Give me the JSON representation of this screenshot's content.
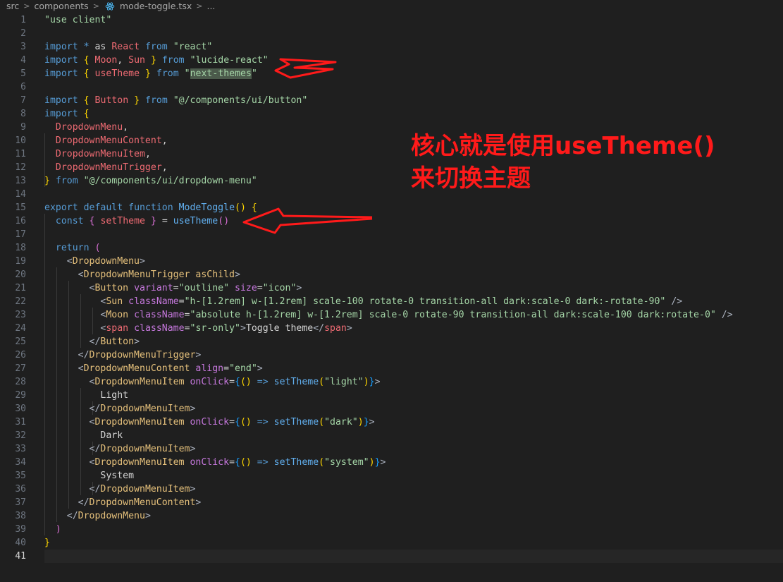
{
  "breadcrumb": {
    "items": [
      "src",
      "components",
      "mode-toggle.tsx",
      "..."
    ],
    "separator": ">",
    "file_icon": "react-icon"
  },
  "annotation": {
    "line1": "核心就是使用useTheme()",
    "line2": "来切换主题",
    "color": "#ff1a1a"
  },
  "editor": {
    "current_line": 41,
    "lines": [
      {
        "n": "1",
        "tokens": [
          [
            "\"use client\"",
            "t-str"
          ]
        ]
      },
      {
        "n": "2",
        "tokens": []
      },
      {
        "n": "3",
        "tokens": [
          [
            "import",
            "t-blue"
          ],
          [
            " ",
            "t-txt"
          ],
          [
            "*",
            "t-blue"
          ],
          [
            " as ",
            "t-txt"
          ],
          [
            "React",
            "t-imp"
          ],
          [
            " ",
            "t-txt"
          ],
          [
            "from",
            "t-blue"
          ],
          [
            " ",
            "t-txt"
          ],
          [
            "\"react\"",
            "t-str"
          ]
        ]
      },
      {
        "n": "4",
        "tokens": [
          [
            "import",
            "t-blue"
          ],
          [
            " ",
            "t-txt"
          ],
          [
            "{",
            "t-br1"
          ],
          [
            " ",
            "t-txt"
          ],
          [
            "Moon",
            "t-imp"
          ],
          [
            ", ",
            "t-txt"
          ],
          [
            "Sun",
            "t-imp"
          ],
          [
            " ",
            "t-txt"
          ],
          [
            "}",
            "t-br1"
          ],
          [
            " ",
            "t-txt"
          ],
          [
            "from",
            "t-blue"
          ],
          [
            " ",
            "t-txt"
          ],
          [
            "\"lucide-react\"",
            "t-str"
          ]
        ]
      },
      {
        "n": "5",
        "tokens": [
          [
            "import",
            "t-blue"
          ],
          [
            " ",
            "t-txt"
          ],
          [
            "{",
            "t-br1"
          ],
          [
            " ",
            "t-txt"
          ],
          [
            "useTheme",
            "t-imp"
          ],
          [
            " ",
            "t-txt"
          ],
          [
            "}",
            "t-br1"
          ],
          [
            " ",
            "t-txt"
          ],
          [
            "from",
            "t-blue"
          ],
          [
            " ",
            "t-txt"
          ],
          [
            "\"",
            "t-str"
          ],
          [
            "next-themes",
            "t-hl"
          ],
          [
            "\"",
            "t-str"
          ]
        ]
      },
      {
        "n": "6",
        "tokens": []
      },
      {
        "n": "7",
        "tokens": [
          [
            "import",
            "t-blue"
          ],
          [
            " ",
            "t-txt"
          ],
          [
            "{",
            "t-br1"
          ],
          [
            " ",
            "t-txt"
          ],
          [
            "Button",
            "t-imp"
          ],
          [
            " ",
            "t-txt"
          ],
          [
            "}",
            "t-br1"
          ],
          [
            " ",
            "t-txt"
          ],
          [
            "from",
            "t-blue"
          ],
          [
            " ",
            "t-txt"
          ],
          [
            "\"@/components/ui/button\"",
            "t-str"
          ]
        ]
      },
      {
        "n": "8",
        "tokens": [
          [
            "import",
            "t-blue"
          ],
          [
            " ",
            "t-txt"
          ],
          [
            "{",
            "t-br1"
          ]
        ]
      },
      {
        "n": "9",
        "tokens": [
          [
            "  ",
            "t-txt"
          ],
          [
            "DropdownMenu",
            "t-imp"
          ],
          [
            ",",
            "t-txt"
          ]
        ]
      },
      {
        "n": "10",
        "tokens": [
          [
            "  ",
            "t-txt"
          ],
          [
            "DropdownMenuContent",
            "t-imp"
          ],
          [
            ",",
            "t-txt"
          ]
        ]
      },
      {
        "n": "11",
        "tokens": [
          [
            "  ",
            "t-txt"
          ],
          [
            "DropdownMenuItem",
            "t-imp"
          ],
          [
            ",",
            "t-txt"
          ]
        ]
      },
      {
        "n": "12",
        "tokens": [
          [
            "  ",
            "t-txt"
          ],
          [
            "DropdownMenuTrigger",
            "t-imp"
          ],
          [
            ",",
            "t-txt"
          ]
        ]
      },
      {
        "n": "13",
        "tokens": [
          [
            "}",
            "t-br1"
          ],
          [
            " ",
            "t-txt"
          ],
          [
            "from",
            "t-blue"
          ],
          [
            " ",
            "t-txt"
          ],
          [
            "\"@/components/ui/dropdown-menu\"",
            "t-str"
          ]
        ]
      },
      {
        "n": "14",
        "tokens": []
      },
      {
        "n": "15",
        "tokens": [
          [
            "export",
            "t-blue"
          ],
          [
            " ",
            "t-txt"
          ],
          [
            "default",
            "t-blue"
          ],
          [
            " ",
            "t-txt"
          ],
          [
            "function",
            "t-blue"
          ],
          [
            " ",
            "t-txt"
          ],
          [
            "ModeToggle",
            "t-fn"
          ],
          [
            "()",
            "t-br1"
          ],
          [
            " ",
            "t-txt"
          ],
          [
            "{",
            "t-br1"
          ]
        ]
      },
      {
        "n": "16",
        "tokens": [
          [
            "  ",
            "t-txt"
          ],
          [
            "const",
            "t-blue"
          ],
          [
            " ",
            "t-txt"
          ],
          [
            "{",
            "t-br2"
          ],
          [
            " ",
            "t-txt"
          ],
          [
            "setTheme",
            "t-imp"
          ],
          [
            " ",
            "t-txt"
          ],
          [
            "}",
            "t-br2"
          ],
          [
            " = ",
            "t-txt"
          ],
          [
            "useTheme",
            "t-fn"
          ],
          [
            "()",
            "t-br2"
          ]
        ]
      },
      {
        "n": "17",
        "tokens": []
      },
      {
        "n": "18",
        "tokens": [
          [
            "  ",
            "t-txt"
          ],
          [
            "return",
            "t-blue"
          ],
          [
            " ",
            "t-txt"
          ],
          [
            "(",
            "t-br2"
          ]
        ]
      },
      {
        "n": "19",
        "tokens": [
          [
            "    ",
            "t-txt"
          ],
          [
            "<",
            "t-punc"
          ],
          [
            "DropdownMenu",
            "t-jsx"
          ],
          [
            ">",
            "t-punc"
          ]
        ]
      },
      {
        "n": "20",
        "tokens": [
          [
            "      ",
            "t-txt"
          ],
          [
            "<",
            "t-punc"
          ],
          [
            "DropdownMenuTrigger",
            "t-jsx"
          ],
          [
            " ",
            "t-txt"
          ],
          [
            "asChild",
            "t-jsx"
          ],
          [
            ">",
            "t-punc"
          ]
        ]
      },
      {
        "n": "21",
        "tokens": [
          [
            "        ",
            "t-txt"
          ],
          [
            "<",
            "t-punc"
          ],
          [
            "Button",
            "t-jsx"
          ],
          [
            " ",
            "t-txt"
          ],
          [
            "variant",
            "t-attr"
          ],
          [
            "=",
            "t-txt"
          ],
          [
            "\"outline\"",
            "t-str"
          ],
          [
            " ",
            "t-txt"
          ],
          [
            "size",
            "t-attr"
          ],
          [
            "=",
            "t-txt"
          ],
          [
            "\"icon\"",
            "t-str"
          ],
          [
            ">",
            "t-punc"
          ]
        ]
      },
      {
        "n": "22",
        "tokens": [
          [
            "          ",
            "t-txt"
          ],
          [
            "<",
            "t-punc"
          ],
          [
            "Sun",
            "t-jsx"
          ],
          [
            " ",
            "t-txt"
          ],
          [
            "className",
            "t-attr"
          ],
          [
            "=",
            "t-txt"
          ],
          [
            "\"h-[1.2rem] w-[1.2rem] scale-100 rotate-0 transition-all dark:scale-0 dark:-rotate-90\"",
            "t-str"
          ],
          [
            " />",
            "t-punc"
          ]
        ]
      },
      {
        "n": "23",
        "tokens": [
          [
            "          ",
            "t-txt"
          ],
          [
            "<",
            "t-punc"
          ],
          [
            "Moon",
            "t-jsx"
          ],
          [
            " ",
            "t-txt"
          ],
          [
            "className",
            "t-attr"
          ],
          [
            "=",
            "t-txt"
          ],
          [
            "\"absolute h-[1.2rem] w-[1.2rem] scale-0 rotate-90 transition-all dark:scale-100 dark:rotate-0\"",
            "t-str"
          ],
          [
            " />",
            "t-punc"
          ]
        ]
      },
      {
        "n": "24",
        "tokens": [
          [
            "          ",
            "t-txt"
          ],
          [
            "<",
            "t-punc"
          ],
          [
            "span",
            "t-tag"
          ],
          [
            " ",
            "t-txt"
          ],
          [
            "className",
            "t-attr"
          ],
          [
            "=",
            "t-txt"
          ],
          [
            "\"sr-only\"",
            "t-str"
          ],
          [
            ">",
            "t-punc"
          ],
          [
            "Toggle theme",
            "t-txt"
          ],
          [
            "</",
            "t-punc"
          ],
          [
            "span",
            "t-tag"
          ],
          [
            ">",
            "t-punc"
          ]
        ]
      },
      {
        "n": "25",
        "tokens": [
          [
            "        ",
            "t-txt"
          ],
          [
            "</",
            "t-punc"
          ],
          [
            "Button",
            "t-jsx"
          ],
          [
            ">",
            "t-punc"
          ]
        ]
      },
      {
        "n": "26",
        "tokens": [
          [
            "      ",
            "t-txt"
          ],
          [
            "</",
            "t-punc"
          ],
          [
            "DropdownMenuTrigger",
            "t-jsx"
          ],
          [
            ">",
            "t-punc"
          ]
        ]
      },
      {
        "n": "27",
        "tokens": [
          [
            "      ",
            "t-txt"
          ],
          [
            "<",
            "t-punc"
          ],
          [
            "DropdownMenuContent",
            "t-jsx"
          ],
          [
            " ",
            "t-txt"
          ],
          [
            "align",
            "t-attr"
          ],
          [
            "=",
            "t-txt"
          ],
          [
            "\"end\"",
            "t-str"
          ],
          [
            ">",
            "t-punc"
          ]
        ]
      },
      {
        "n": "28",
        "tokens": [
          [
            "        ",
            "t-txt"
          ],
          [
            "<",
            "t-punc"
          ],
          [
            "DropdownMenuItem",
            "t-jsx"
          ],
          [
            " ",
            "t-txt"
          ],
          [
            "onClick",
            "t-attr"
          ],
          [
            "=",
            "t-txt"
          ],
          [
            "{",
            "t-br3"
          ],
          [
            "()",
            "t-br1"
          ],
          [
            " => ",
            "t-blue"
          ],
          [
            "setTheme",
            "t-fn"
          ],
          [
            "(",
            "t-br1"
          ],
          [
            "\"light\"",
            "t-str"
          ],
          [
            ")",
            "t-br1"
          ],
          [
            "}",
            "t-br3"
          ],
          [
            ">",
            "t-punc"
          ]
        ]
      },
      {
        "n": "29",
        "tokens": [
          [
            "          Light",
            "t-txt"
          ]
        ]
      },
      {
        "n": "30",
        "tokens": [
          [
            "        ",
            "t-txt"
          ],
          [
            "</",
            "t-punc"
          ],
          [
            "DropdownMenuItem",
            "t-jsx"
          ],
          [
            ">",
            "t-punc"
          ]
        ]
      },
      {
        "n": "31",
        "tokens": [
          [
            "        ",
            "t-txt"
          ],
          [
            "<",
            "t-punc"
          ],
          [
            "DropdownMenuItem",
            "t-jsx"
          ],
          [
            " ",
            "t-txt"
          ],
          [
            "onClick",
            "t-attr"
          ],
          [
            "=",
            "t-txt"
          ],
          [
            "{",
            "t-br3"
          ],
          [
            "()",
            "t-br1"
          ],
          [
            " => ",
            "t-blue"
          ],
          [
            "setTheme",
            "t-fn"
          ],
          [
            "(",
            "t-br1"
          ],
          [
            "\"dark\"",
            "t-str"
          ],
          [
            ")",
            "t-br1"
          ],
          [
            "}",
            "t-br3"
          ],
          [
            ">",
            "t-punc"
          ]
        ]
      },
      {
        "n": "32",
        "tokens": [
          [
            "          Dark",
            "t-txt"
          ]
        ]
      },
      {
        "n": "33",
        "tokens": [
          [
            "        ",
            "t-txt"
          ],
          [
            "</",
            "t-punc"
          ],
          [
            "DropdownMenuItem",
            "t-jsx"
          ],
          [
            ">",
            "t-punc"
          ]
        ]
      },
      {
        "n": "34",
        "tokens": [
          [
            "        ",
            "t-txt"
          ],
          [
            "<",
            "t-punc"
          ],
          [
            "DropdownMenuItem",
            "t-jsx"
          ],
          [
            " ",
            "t-txt"
          ],
          [
            "onClick",
            "t-attr"
          ],
          [
            "=",
            "t-txt"
          ],
          [
            "{",
            "t-br3"
          ],
          [
            "()",
            "t-br1"
          ],
          [
            " => ",
            "t-blue"
          ],
          [
            "setTheme",
            "t-fn"
          ],
          [
            "(",
            "t-br1"
          ],
          [
            "\"system\"",
            "t-str"
          ],
          [
            ")",
            "t-br1"
          ],
          [
            "}",
            "t-br3"
          ],
          [
            ">",
            "t-punc"
          ]
        ]
      },
      {
        "n": "35",
        "tokens": [
          [
            "          System",
            "t-txt"
          ]
        ]
      },
      {
        "n": "36",
        "tokens": [
          [
            "        ",
            "t-txt"
          ],
          [
            "</",
            "t-punc"
          ],
          [
            "DropdownMenuItem",
            "t-jsx"
          ],
          [
            ">",
            "t-punc"
          ]
        ]
      },
      {
        "n": "37",
        "tokens": [
          [
            "      ",
            "t-txt"
          ],
          [
            "</",
            "t-punc"
          ],
          [
            "DropdownMenuContent",
            "t-jsx"
          ],
          [
            ">",
            "t-punc"
          ]
        ]
      },
      {
        "n": "38",
        "tokens": [
          [
            "    ",
            "t-txt"
          ],
          [
            "</",
            "t-punc"
          ],
          [
            "DropdownMenu",
            "t-jsx"
          ],
          [
            ">",
            "t-punc"
          ]
        ]
      },
      {
        "n": "39",
        "tokens": [
          [
            "  ",
            "t-txt"
          ],
          [
            ")",
            "t-br2"
          ]
        ]
      },
      {
        "n": "40",
        "tokens": [
          [
            "}",
            "t-br1"
          ]
        ]
      },
      {
        "n": "41",
        "tokens": []
      }
    ]
  }
}
